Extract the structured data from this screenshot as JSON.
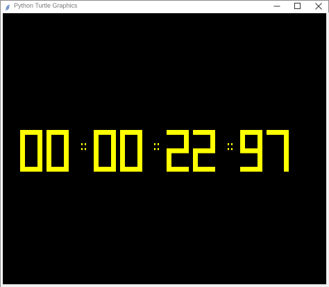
{
  "window": {
    "title": "Python Turtle Graphics",
    "icons": {
      "app": "feather-icon",
      "minimize": "minimize-icon",
      "maximize": "maximize-icon",
      "close": "close-icon"
    }
  },
  "clock": {
    "display": "00:00:22:97",
    "digits": [
      "0",
      "0",
      "0",
      "0",
      "2",
      "2",
      "9",
      "7"
    ],
    "digit_color": "#ffff00",
    "background_color": "#000000"
  }
}
